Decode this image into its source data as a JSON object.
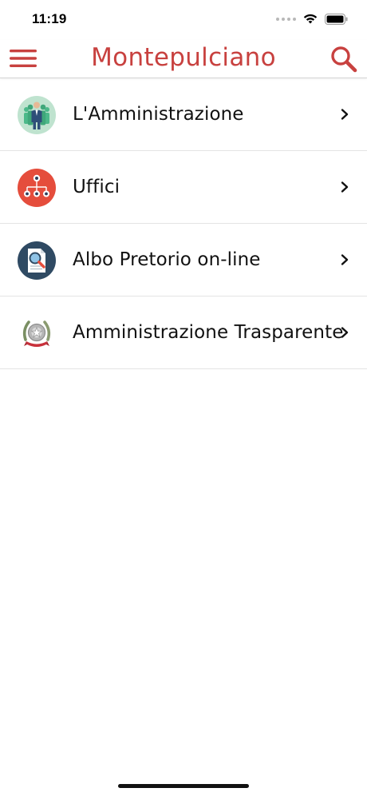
{
  "status_bar": {
    "time": "11:19"
  },
  "header": {
    "title": "Montepulciano",
    "accent_color": "#c8413f"
  },
  "menu_items": [
    {
      "label": "L'Amministrazione",
      "icon": "people-group-icon"
    },
    {
      "label": "Uffici",
      "icon": "org-chart-icon"
    },
    {
      "label": "Albo Pretorio on-line",
      "icon": "document-search-icon"
    },
    {
      "label": "Amministrazione Trasparente",
      "icon": "italian-emblem-icon"
    }
  ]
}
